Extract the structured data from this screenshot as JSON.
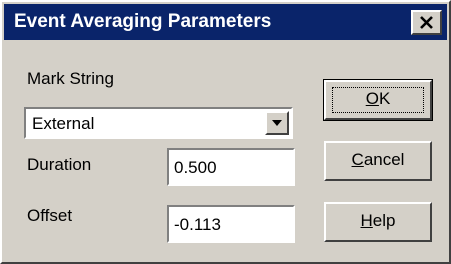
{
  "dialog": {
    "title": "Event Averaging Parameters",
    "close_icon": "close-icon"
  },
  "mark_string": {
    "label": "Mark String",
    "selected": "External"
  },
  "duration": {
    "label": "Duration",
    "value": "0.500"
  },
  "offset": {
    "label": "Offset",
    "value": "-0.113"
  },
  "buttons": {
    "ok": {
      "accel": "O",
      "rest": "K"
    },
    "cancel": {
      "accel": "C",
      "rest": "ancel"
    },
    "help": {
      "accel": "H",
      "rest": "elp"
    }
  },
  "colors": {
    "titlebar": "#0a246a",
    "face": "#d4d0c8"
  }
}
